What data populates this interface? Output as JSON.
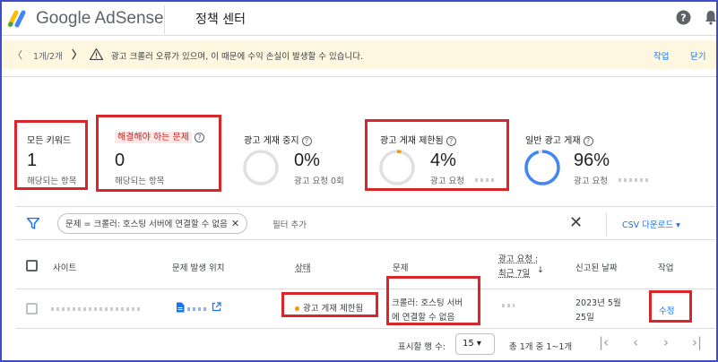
{
  "header": {
    "brand": "Google AdSense",
    "page_title": "정책 센터"
  },
  "banner": {
    "prev": "〈",
    "count": "1개/2개",
    "next": "〉",
    "message": "광고 크롤러 오류가 있으며, 이 때문에 수익 손실이 발생할 수 있습니다.",
    "action": "작업",
    "close": "닫기"
  },
  "stats": {
    "all": {
      "title": "모든 키워드",
      "value": "1",
      "sub": "해당되는 항목"
    },
    "needs_fix": {
      "title": "해결해야 하는 문제",
      "value": "0",
      "sub": "해당되는 항목"
    },
    "stopped": {
      "title": "광고 게재 중지",
      "value": "0%",
      "sub": "광고 요청 0회",
      "ratio": 0
    },
    "limited": {
      "title": "광고 게재 제한됨",
      "value": "4%",
      "sub": "광고 요청",
      "ratio": 0.04
    },
    "normal": {
      "title": "일반 광고 게재",
      "value": "96%",
      "sub": "광고 요청",
      "ratio": 0.96
    }
  },
  "filter": {
    "chip": "문제 = 크롤러: 호스팅 서버에 연결할 수 없음",
    "chip_close": "✕",
    "add": "필터 추가",
    "clear": "✕",
    "csv": "CSV 다운로드 ▾"
  },
  "table": {
    "headers": {
      "site": "사이트",
      "location": "문제 발생 위치",
      "status": "상태",
      "issue": "문제",
      "requests_line1": "광고 요청 :",
      "requests_line2": "최근 7일",
      "reported": "신고된 날짜",
      "action": "작업"
    },
    "rows": [
      {
        "status": "광고 게재 제한됨",
        "issue_line1": "크롤러: 호스팅 서버",
        "issue_line2": "에 연결할 수 없음",
        "reported_line1": "2023년 5월",
        "reported_line2": "25일",
        "action": "수정"
      }
    ]
  },
  "footer": {
    "rows_label": "표시할 행 수:",
    "rows_value": "15 ▾",
    "range": "총 1개 중 1~1개"
  },
  "colors": {
    "accent": "#1a73e8",
    "highlight_box": "#d9262a",
    "warning": "#f29900",
    "donut_track": "#e0e0e0"
  }
}
